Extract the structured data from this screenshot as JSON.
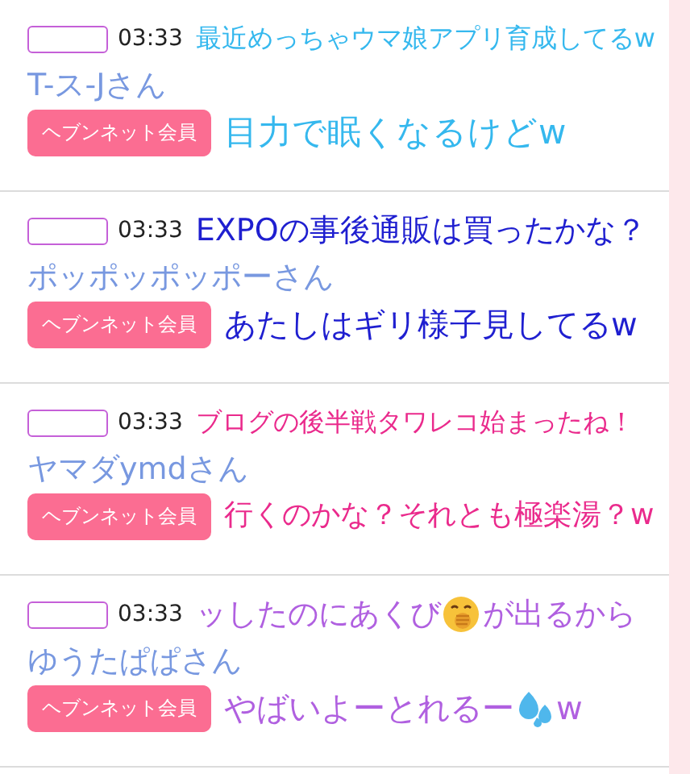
{
  "posts": [
    {
      "time": "03:33",
      "name": "T-ス-Jさん",
      "badge": "ヘブンネット会員",
      "color": "#35b8ee",
      "captions": [
        [
          {
            "kind": "text",
            "text": "最近めっちゃウマ娘アプリ育成してるw"
          }
        ],
        [
          {
            "kind": "text",
            "text": "目力で眠くなるけどw"
          }
        ]
      ]
    },
    {
      "time": "03:33",
      "name": "ポッポッポッポーさん",
      "badge": "ヘブンネット会員",
      "color": "#1f1fd0",
      "captions": [
        [
          {
            "kind": "text",
            "text": "EXPOの事後通販は買ったかな？"
          }
        ],
        [
          {
            "kind": "text",
            "text": "あたしはギリ様子見してるw"
          }
        ]
      ]
    },
    {
      "time": "03:33",
      "name": "ヤマダymdさん",
      "badge": "ヘブンネット会員",
      "color": "#ea2a8c",
      "captions": [
        [
          {
            "kind": "text",
            "text": "ブログの後半戦タワレコ始まったね！"
          }
        ],
        [
          {
            "kind": "text",
            "text": "行くのかな？それとも極楽湯？w"
          }
        ]
      ]
    },
    {
      "time": "03:33",
      "name": "ゆうたぱぱさん",
      "badge": "ヘブンネット会員",
      "color": "#b060e0",
      "captions": [
        [
          {
            "kind": "text",
            "text": "ッしたのにあくび"
          },
          {
            "kind": "yawn"
          },
          {
            "kind": "text",
            "text": "が出るから"
          }
        ],
        [
          {
            "kind": "text",
            "text": "やばいよーとれるー"
          },
          {
            "kind": "drops"
          },
          {
            "kind": "text",
            "text": "w"
          }
        ]
      ]
    }
  ]
}
